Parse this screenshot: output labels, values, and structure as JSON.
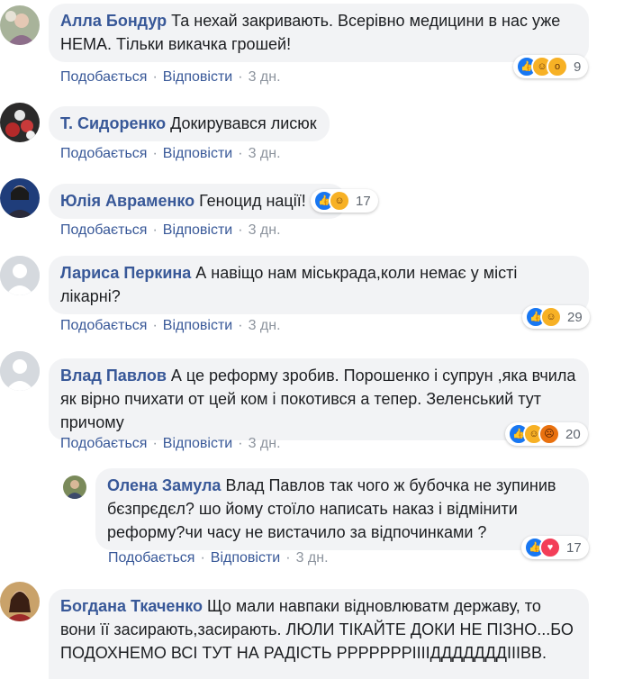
{
  "theme": {
    "author_color": "#385898",
    "bubble_bg": "#f2f3f5",
    "meta_color": "#8d949e",
    "like_color": "#1877f2"
  },
  "actions": {
    "like": "Подобається",
    "reply": "Відповісти",
    "separator": "·"
  },
  "comments": [
    {
      "author": "Алла Бондур",
      "text": "Та нехай закривають. Всерівно медицини в нас уже НЕМА. Тільки викачка грошей!",
      "time": "3 дн.",
      "reactions": [
        "like-icon",
        "haha-icon",
        "wow-icon"
      ],
      "count": "9"
    },
    {
      "author": "Т. Сидоренко",
      "text": "Докирувався лисюк",
      "time": "3 дн.",
      "reactions": [],
      "count": ""
    },
    {
      "author": "Юлія Авраменко",
      "text": "Геноцид нації!",
      "time": "3 дн.",
      "reactions": [
        "like-icon",
        "haha-icon"
      ],
      "count": "17"
    },
    {
      "author": "Лариса Перкина",
      "text": "А навіщо нам міськрада,коли немає у місті лікарні?",
      "time": "3 дн.",
      "reactions": [
        "like-icon",
        "haha-icon"
      ],
      "count": "29"
    },
    {
      "author": "Влад Павлов",
      "text": "А це реформу зробив. Порошенко і супрун ,яка вчила як вірно пчихати от цей ком і покотився а тепер. Зеленський тут причому",
      "time": "3 дн.",
      "reactions": [
        "like-icon",
        "haha-icon",
        "angry-icon"
      ],
      "count": "20"
    },
    {
      "author": "Олена Замула",
      "text": "Влад Павлов так чого ж бубочка не зупинив бєзпрєдєл? шо йому стоїло написать наказ і відмінити реформу?чи часу не вистачило за відпочинками ?",
      "time": "3 дн.",
      "reactions": [
        "like-icon",
        "love-icon"
      ],
      "count": "17"
    },
    {
      "author": "Богдана Ткаченко",
      "text": "Що мали навпаки відновлюватм державу, то вони її засирають,засирають. ЛЮЛИ ТІКАЙТЕ ДОКИ НЕ ПІЗНО...БО ПОДОХНЕМО ВСІ ТУТ НА РАДІСТЬ РРРРРРРІІІІДДДДДДДІІІВВ.",
      "time": "",
      "reactions": [],
      "count": ""
    }
  ]
}
